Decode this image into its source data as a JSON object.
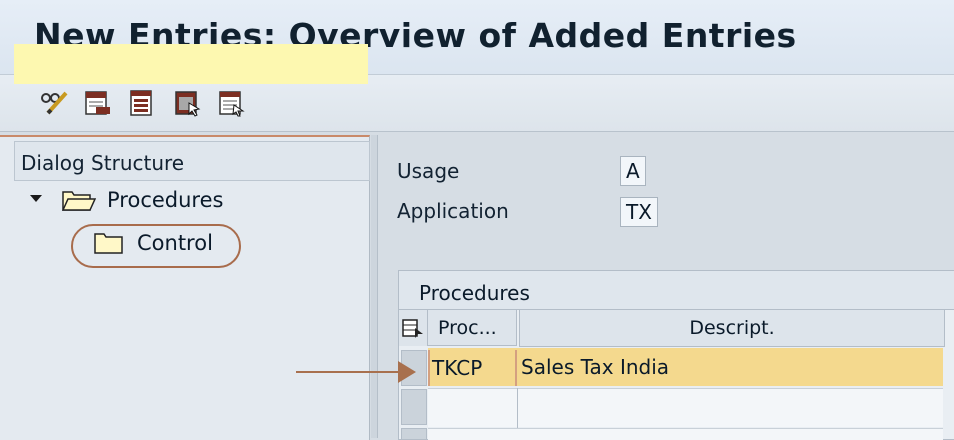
{
  "window": {
    "title": "New Entries: Overview of Added Entries"
  },
  "toolbar": {
    "buttons": [
      {
        "icon": "pencil-glasses-icon"
      },
      {
        "icon": "delete-row-icon"
      },
      {
        "icon": "copy-entries-icon"
      },
      {
        "icon": "select-all-icon"
      },
      {
        "icon": "document-details-icon"
      }
    ]
  },
  "dialog_structure": {
    "header": "Dialog Structure",
    "items": [
      {
        "label": "Procedures",
        "expanded": true,
        "selected": true
      },
      {
        "label": "Control",
        "expanded": false,
        "selected": false,
        "annotated": true
      }
    ]
  },
  "fields": {
    "usage": {
      "label": "Usage",
      "value": "A"
    },
    "application": {
      "label": "Application",
      "value": "TX"
    }
  },
  "procedures_table": {
    "title": "Procedures",
    "columns": [
      "Proc...",
      "Descript."
    ],
    "rows": [
      {
        "procedure": "TKCP",
        "description": "Sales Tax India",
        "highlighted": true
      },
      {
        "procedure": "",
        "description": ""
      },
      {
        "procedure": "",
        "description": ""
      }
    ]
  },
  "colors": {
    "selected_row": "#fdf8b0",
    "highlight_row": "#f4d98e",
    "annotation": "#a86c4c"
  }
}
